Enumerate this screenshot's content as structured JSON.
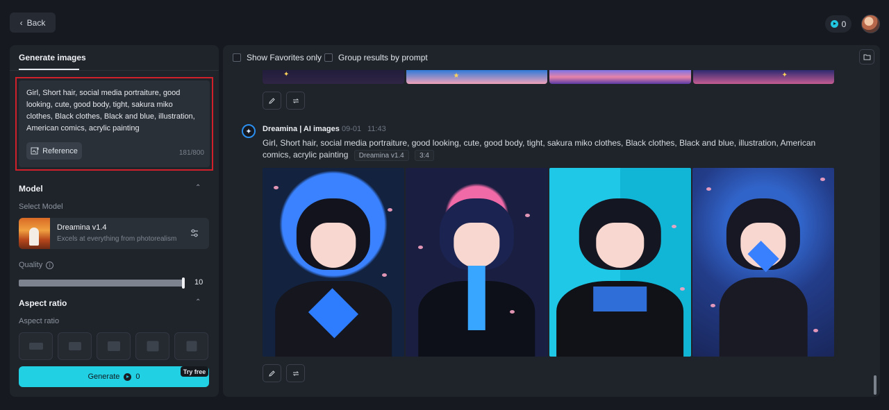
{
  "topbar": {
    "back_label": "Back",
    "credits": "0"
  },
  "left_panel": {
    "tab": "Generate images",
    "prompt": "Girl, Short hair, social media portraiture, good looking, cute, good body, tight, sakura miko clothes, Black clothes, Black and blue, illustration, American comics, acrylic painting",
    "reference_label": "Reference",
    "char_count": "181/800",
    "model_section": "Model",
    "select_model_label": "Select Model",
    "model_name": "Dreamina v1.4",
    "model_desc": "Excels at everything from photorealism",
    "quality_label": "Quality",
    "quality_value": "10",
    "aspect_section": "Aspect ratio",
    "aspect_label": "Aspect ratio",
    "generate_label": "Generate",
    "generate_cost": "0",
    "try_free": "Try free"
  },
  "main_panel": {
    "filters": [
      "Show Favorites only",
      "Group results by prompt"
    ],
    "result": {
      "bot_name": "Dreamina | AI images",
      "date": "09-01",
      "time": "11:43",
      "prompt": "Girl, Short hair, social media portraiture, good looking, cute, good body, tight, sakura miko clothes, Black clothes, Black and blue, illustration, American comics, acrylic painting",
      "tags": [
        "Dreamina v1.4",
        "3:4"
      ]
    }
  },
  "icons": {
    "back": "chevron-left-icon",
    "credits": "coin-icon",
    "folder": "folder-icon",
    "edit": "pencil-icon",
    "regenerate": "repeat-icon",
    "settings": "sliders-icon",
    "info": "info-icon"
  },
  "colors": {
    "accent": "#22d0e4",
    "highlight_border": "#d0202a",
    "background": "#161a20",
    "panel": "#1f242b"
  }
}
